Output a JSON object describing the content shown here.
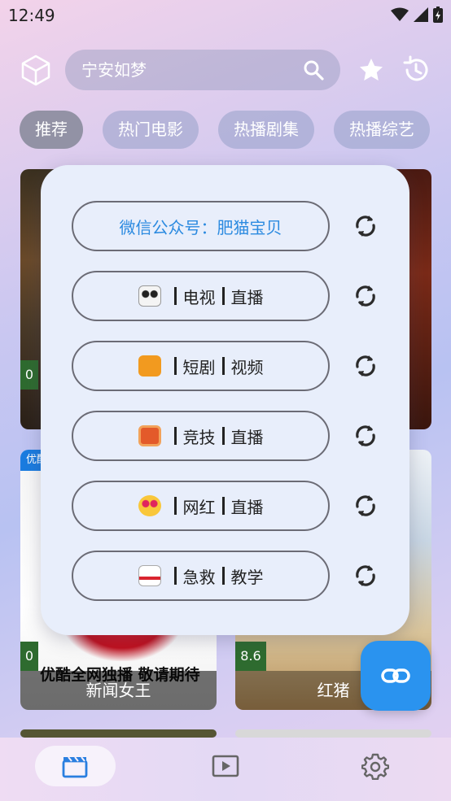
{
  "status_bar": {
    "time": "12:49"
  },
  "header": {
    "search_placeholder": "宁安如梦"
  },
  "chips": [
    "推荐",
    "热门电影",
    "热播剧集",
    "热播综艺"
  ],
  "cards": [
    {
      "score": "0",
      "title": ""
    },
    {
      "score": "",
      "title": ""
    },
    {
      "score": "0",
      "title": "新闻女王",
      "badge": "优酷",
      "poster_text": "优酷全网独播 敬请期待"
    },
    {
      "score": "8.6",
      "title": "红猪"
    }
  ],
  "popup": {
    "sources": [
      {
        "label": "微信公众号：肥猫宝贝",
        "emoji": "",
        "parts": []
      },
      {
        "label": "",
        "emoji": "panda",
        "parts": [
          "电视",
          "直播"
        ]
      },
      {
        "label": "",
        "emoji": "play-pause",
        "parts": [
          "短剧",
          "视频"
        ]
      },
      {
        "label": "",
        "emoji": "television",
        "parts": [
          "竞技",
          "直播"
        ]
      },
      {
        "label": "",
        "emoji": "heart-eyes",
        "parts": [
          "网红",
          "直播"
        ]
      },
      {
        "label": "",
        "emoji": "ambulance",
        "parts": [
          "急救",
          "教学"
        ]
      }
    ]
  },
  "colors": {
    "accent": "#2a93ef",
    "score_bg": "#2e6b2f",
    "link_blue": "#2b8ae0"
  }
}
